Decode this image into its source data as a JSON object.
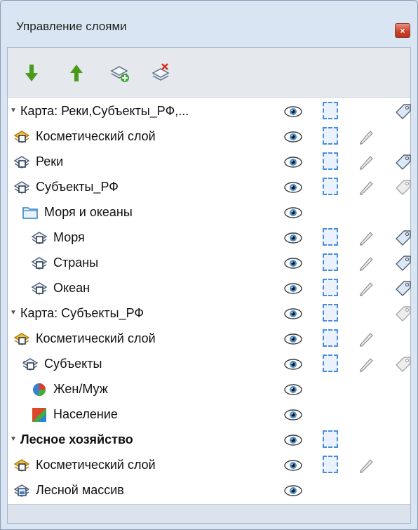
{
  "window": {
    "title": "Управление слоями",
    "close_label": "×"
  },
  "toolbar": {
    "buttons": [
      {
        "name": "move-down-button",
        "icon": "arrow-down-icon",
        "color": "#4c9a1a"
      },
      {
        "name": "move-up-button",
        "icon": "arrow-up-icon",
        "color": "#4c9a1a"
      },
      {
        "name": "add-layer-button",
        "icon": "add-layer-icon"
      },
      {
        "name": "remove-layer-button",
        "icon": "remove-layer-icon"
      }
    ]
  },
  "tree": {
    "rows": [
      {
        "label": "Карта: Реки,Субъекты_РФ,...",
        "indent": 0,
        "expander": "▼",
        "icon": "none",
        "bold": false,
        "eye": true,
        "select": true,
        "edit": false,
        "tag": "enabled"
      },
      {
        "label": "Косметический слой",
        "indent": 1,
        "expander": "",
        "icon": "cosmetic-layer-icon",
        "bold": false,
        "eye": true,
        "select": true,
        "edit": true,
        "tag": "none"
      },
      {
        "label": "Реки",
        "indent": 1,
        "expander": "",
        "icon": "vector-layer-icon",
        "bold": false,
        "eye": true,
        "select": true,
        "edit": true,
        "tag": "enabled"
      },
      {
        "label": "Субъекты_РФ",
        "indent": 1,
        "expander": "",
        "icon": "vector-layer-icon",
        "bold": false,
        "eye": true,
        "select": true,
        "edit": true,
        "tag": "disabled"
      },
      {
        "label": "Моря и океаны",
        "indent": 1,
        "expander": "▼",
        "icon": "folder-icon",
        "bold": false,
        "eye": true,
        "select": false,
        "edit": false,
        "tag": "none"
      },
      {
        "label": "Моря",
        "indent": 2,
        "expander": "",
        "icon": "vector-layer-icon",
        "bold": false,
        "eye": true,
        "select": true,
        "edit": true,
        "tag": "enabled"
      },
      {
        "label": "Страны",
        "indent": 2,
        "expander": "",
        "icon": "vector-layer-icon",
        "bold": false,
        "eye": true,
        "select": true,
        "edit": true,
        "tag": "enabled"
      },
      {
        "label": "Океан",
        "indent": 2,
        "expander": "",
        "icon": "vector-layer-icon",
        "bold": false,
        "eye": true,
        "select": true,
        "edit": true,
        "tag": "enabled"
      },
      {
        "label": "Карта: Субъекты_РФ",
        "indent": 0,
        "expander": "▼",
        "icon": "none",
        "bold": false,
        "eye": true,
        "select": true,
        "edit": false,
        "tag": "disabled"
      },
      {
        "label": "Косметический слой",
        "indent": 1,
        "expander": "",
        "icon": "cosmetic-layer-icon",
        "bold": false,
        "eye": true,
        "select": true,
        "edit": true,
        "tag": "none"
      },
      {
        "label": "Субъекты",
        "indent": 1,
        "expander": "▼",
        "icon": "vector-layer-icon",
        "bold": false,
        "eye": true,
        "select": true,
        "edit": true,
        "tag": "disabled"
      },
      {
        "label": "Жен/Муж",
        "indent": 2,
        "expander": "",
        "icon": "pie-chart-icon",
        "bold": false,
        "eye": true,
        "select": false,
        "edit": false,
        "tag": "none"
      },
      {
        "label": "Население",
        "indent": 2,
        "expander": "",
        "icon": "range-theme-icon",
        "bold": false,
        "eye": true,
        "select": false,
        "edit": false,
        "tag": "none"
      },
      {
        "label": "Лесное хозяйство",
        "indent": 0,
        "expander": "▼",
        "icon": "none",
        "bold": true,
        "eye": true,
        "select": true,
        "edit": false,
        "tag": "none"
      },
      {
        "label": "Косметический слой",
        "indent": 1,
        "expander": "",
        "icon": "cosmetic-layer-icon",
        "bold": false,
        "eye": true,
        "select": true,
        "edit": true,
        "tag": "none"
      },
      {
        "label": "Лесной массив",
        "indent": 1,
        "expander": "",
        "icon": "raster-layer-icon",
        "bold": false,
        "eye": true,
        "select": false,
        "edit": false,
        "tag": "none"
      }
    ]
  }
}
